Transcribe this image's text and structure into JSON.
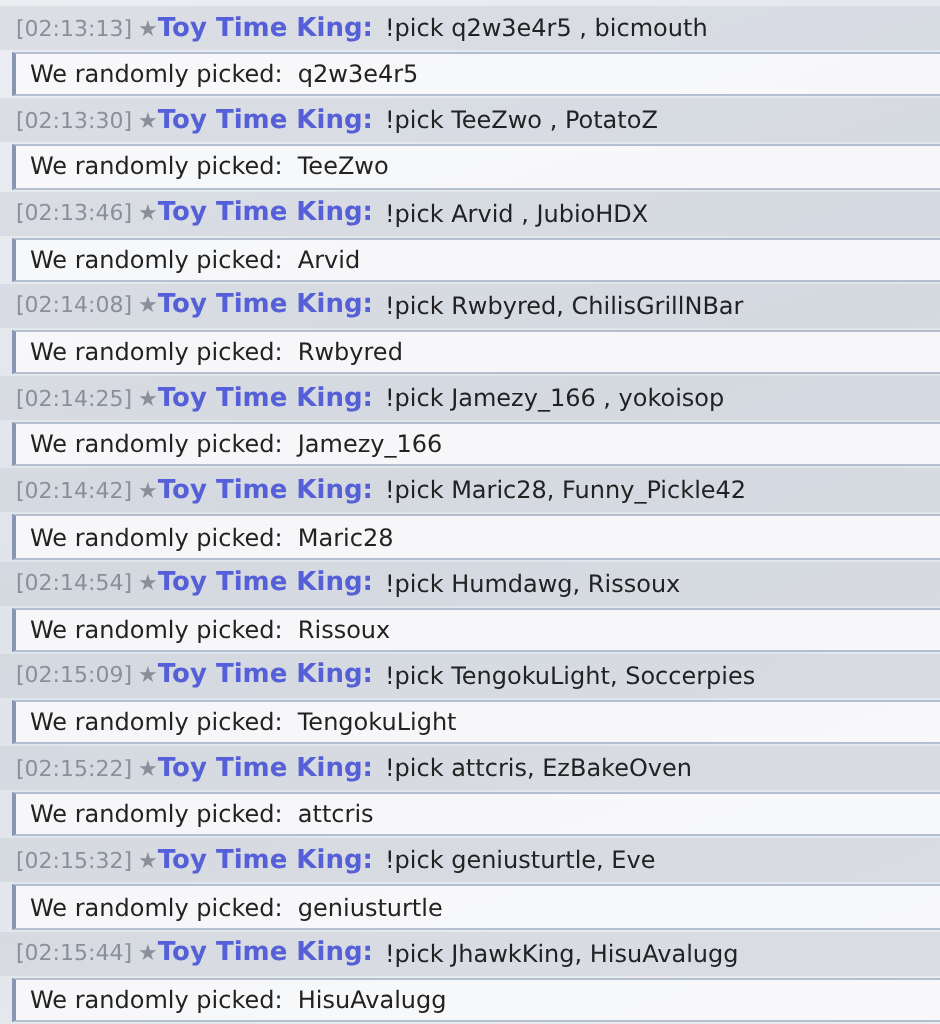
{
  "messages": [
    {
      "time": "[02:13:13]",
      "rank": "★",
      "user": "Toy Time King:",
      "text": "!pick q2w3e4r5 , bicmouth",
      "reply": "We randomly picked:  q2w3e4r5"
    },
    {
      "time": "[02:13:30]",
      "rank": "★",
      "user": "Toy Time King:",
      "text": "!pick TeeZwo , PotatoZ",
      "reply": "We randomly picked:  TeeZwo"
    },
    {
      "time": "[02:13:46]",
      "rank": "★",
      "user": "Toy Time King:",
      "text": "!pick Arvid , JubioHDX",
      "reply": "We randomly picked:  Arvid"
    },
    {
      "time": "[02:14:08]",
      "rank": "★",
      "user": "Toy Time King:",
      "text": "!pick Rwbyred, ChilisGrillNBar",
      "reply": "We randomly picked:  Rwbyred"
    },
    {
      "time": "[02:14:25]",
      "rank": "★",
      "user": "Toy Time King:",
      "text": "!pick Jamezy_166 , yokoisop",
      "reply": "We randomly picked:  Jamezy_166"
    },
    {
      "time": "[02:14:42]",
      "rank": "★",
      "user": "Toy Time King:",
      "text": "!pick Maric28, Funny_Pickle42",
      "reply": "We randomly picked:  Maric28"
    },
    {
      "time": "[02:14:54]",
      "rank": "★",
      "user": "Toy Time King:",
      "text": "!pick Humdawg, Rissoux",
      "reply": "We randomly picked:  Rissoux"
    },
    {
      "time": "[02:15:09]",
      "rank": "★",
      "user": "Toy Time King:",
      "text": "!pick TengokuLight, Soccerpies",
      "reply": "We randomly picked:  TengokuLight"
    },
    {
      "time": "[02:15:22]",
      "rank": "★",
      "user": "Toy Time King:",
      "text": "!pick attcris, EzBakeOven",
      "reply": "We randomly picked:  attcris"
    },
    {
      "time": "[02:15:32]",
      "rank": "★",
      "user": "Toy Time King:",
      "text": "!pick geniusturtle, Eve",
      "reply": "We randomly picked:  geniusturtle"
    },
    {
      "time": "[02:15:44]",
      "rank": "★",
      "user": "Toy Time King:",
      "text": "!pick JhawkKing, HisuAvalugg",
      "reply": "We randomly picked:  HisuAvalugg"
    }
  ]
}
